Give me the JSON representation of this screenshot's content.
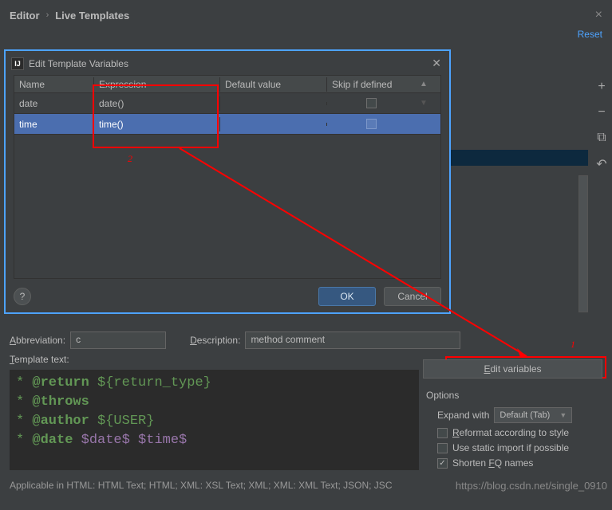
{
  "breadcrumb": {
    "editor": "Editor",
    "live_templates": "Live Templates"
  },
  "reset": "Reset",
  "close": "×",
  "toolbar": {
    "plus": "+",
    "minus": "−",
    "copy": "⧉",
    "undo": "↶"
  },
  "dialog": {
    "title": "Edit Template Variables",
    "columns": {
      "name": "Name",
      "expression": "Expression",
      "default": "Default value",
      "skip": "Skip if defined"
    },
    "rows": [
      {
        "name": "date",
        "expression": "date()",
        "default": "",
        "skip": false
      },
      {
        "name": "time",
        "expression": "time()",
        "default": "",
        "skip": false
      }
    ],
    "ok": "OK",
    "cancel": "Cancel",
    "help": "?"
  },
  "annotations": {
    "one": "1",
    "two": "2"
  },
  "fields": {
    "abbreviation_label": "Abbreviation:",
    "abbreviation_value": "c",
    "description_label": "Description:",
    "description_value": "method comment",
    "template_label": "Template text:"
  },
  "template_lines": [
    {
      "prefix": " * ",
      "tag": "@return",
      "rest": " ${return_type}"
    },
    {
      "prefix": " * ",
      "tag": "@throws",
      "rest": ""
    },
    {
      "prefix": " * ",
      "tag": "@author",
      "rest": " ${USER}"
    },
    {
      "prefix": " * ",
      "tag": "@date",
      "rest_dollar": " $date$ $time$"
    }
  ],
  "side": {
    "edit_vars": "Edit variables",
    "options": "Options",
    "expand_with": "Expand with",
    "expand_value": "Default (Tab)",
    "reformat": "Reformat according to style",
    "static_import": "Use static import if possible",
    "shorten": "Shorten FQ names"
  },
  "applicable": "Applicable in HTML: HTML Text; HTML; XML: XSL Text; XML; XML: XML Text; JSON; JSC",
  "watermark": "https://blog.csdn.net/single_0910"
}
